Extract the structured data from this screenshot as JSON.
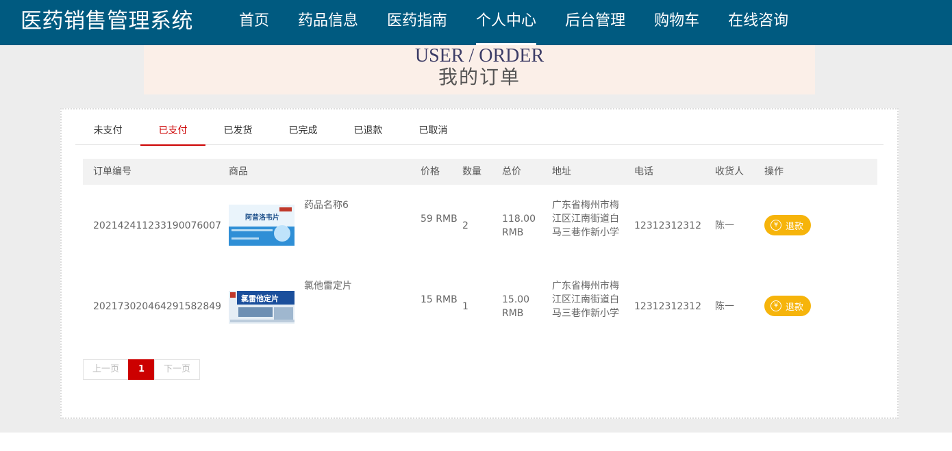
{
  "brand": "医药销售管理系统",
  "nav": [
    "首页",
    "药品信息",
    "医药指南",
    "个人中心",
    "后台管理",
    "购物车",
    "在线咨询"
  ],
  "nav_active_index": 3,
  "banner": {
    "en": "USER / ORDER",
    "cn": "我的订单"
  },
  "tabs": [
    "未支付",
    "已支付",
    "已发货",
    "已完成",
    "已退款",
    "已取消"
  ],
  "tab_active_index": 1,
  "table": {
    "headers": [
      "订单编号",
      "商品",
      "价格",
      "数量",
      "总价",
      "地址",
      "电话",
      "收货人",
      "操作"
    ],
    "rows": [
      {
        "order_no": "20214241123319007600 7",
        "order_no_display": "202142411233190076007",
        "goods_name": "药品名称6",
        "goods_image_text": "阿昔洛韦片",
        "price": "59 RMB",
        "qty": "2",
        "total": "118.00 RMB",
        "address": "广东省梅州市梅江区江南街道白马三巷作新小学",
        "phone": "12312312312",
        "receiver": "陈一",
        "action": "退款"
      },
      {
        "order_no": "202173020464291582849",
        "order_no_display": "202173020464291582849",
        "goods_name": "氯他雷定片",
        "goods_image_text": "氯雷他定片",
        "price": "15 RMB",
        "qty": "1",
        "total": "15.00 RMB",
        "address": "广东省梅州市梅江区江南街道白马三巷作新小学",
        "phone": "12312312312",
        "receiver": "陈一",
        "action": "退款"
      }
    ]
  },
  "pager": {
    "prev": "上一页",
    "current": "1",
    "next": "下一页"
  },
  "colors": {
    "header": "#005a80",
    "accent": "#cc0000",
    "refund": "#f6b40b",
    "banner": "#fbefe8"
  }
}
